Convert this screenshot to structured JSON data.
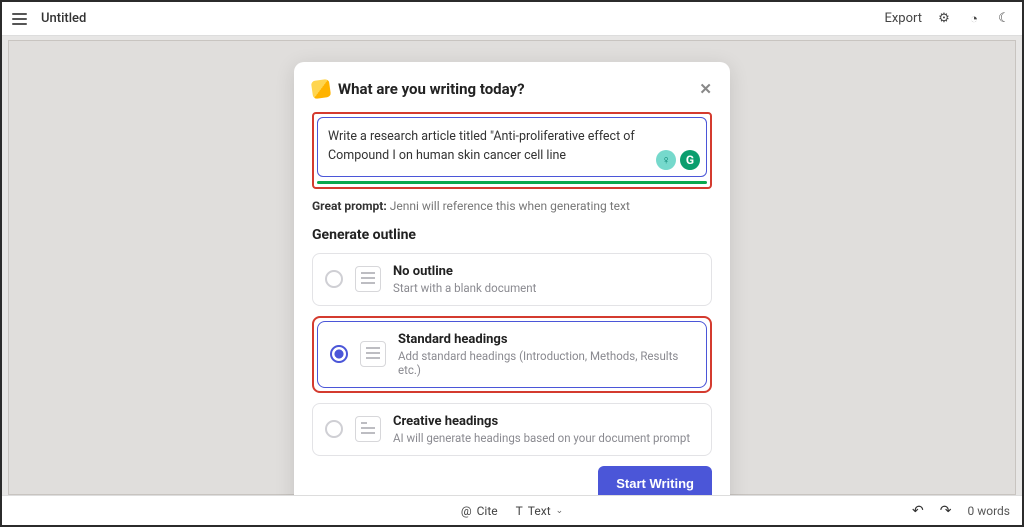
{
  "topbar": {
    "title": "Untitled",
    "export": "Export"
  },
  "modal": {
    "title": "What are you writing today?",
    "prompt_value": "Write a research article titled \"Anti-proliferative effect of Compound I on human skin cancer cell line",
    "helper_label": "Great prompt:",
    "helper_text": "Jenni will reference this when generating text",
    "section": "Generate outline",
    "options": {
      "none": {
        "title": "No outline",
        "sub": "Start with a blank document"
      },
      "standard": {
        "title": "Standard headings",
        "sub": "Add standard headings (Introduction, Methods, Results etc.)"
      },
      "creative": {
        "title": "Creative headings",
        "sub": "AI will generate headings based on your document prompt"
      }
    },
    "start": "Start Writing"
  },
  "bottombar": {
    "cite": "Cite",
    "text": "Text",
    "words": "0 words"
  },
  "icons": {
    "grammarly": "G",
    "bulb": "♀",
    "close": "✕",
    "at": "@",
    "t": "T",
    "undo": "↶",
    "redo": "↷",
    "gear": "⚙",
    "clock": "◔",
    "moon": "☾"
  }
}
